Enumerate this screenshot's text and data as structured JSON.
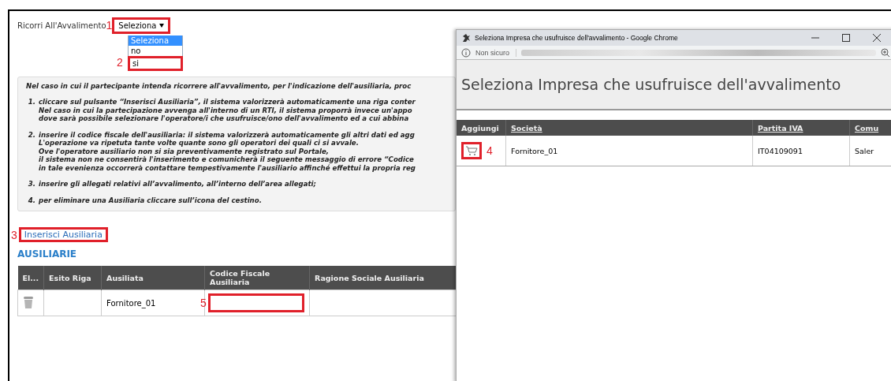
{
  "form": {
    "label": "Ricorri All'Avvalimento",
    "select": {
      "value": "Seleziona",
      "annotation": "1"
    },
    "options": [
      {
        "label": "Seleziona",
        "selected": true,
        "highlighted": false
      },
      {
        "label": "no",
        "selected": false,
        "highlighted": false
      },
      {
        "label": "si",
        "selected": false,
        "highlighted": true,
        "annotation": "2"
      }
    ]
  },
  "instructions": {
    "intro": "Nel caso in cui il partecipante intenda ricorrere all'avvalimento, per l'indicazione dell'ausiliaria, proc",
    "steps": [
      {
        "number": "1.",
        "lines": [
          "cliccare sul pulsante “Inserisci Ausiliaria”, il sistema valorizzerà automaticamente una riga conter",
          "Nel caso in cui la partecipazione avvenga all'interno di un RTI, il sistema proporrà invece un'appo",
          "dove sarà possibile selezionare l'operatore/i che usufruisce/ono dell'avvalimento ed a cui abbina"
        ]
      },
      {
        "number": "2.",
        "lines": [
          "inserire il codice fiscale dell'ausiliaria: il sistema valorizzerà automaticamente gli altri dati ed agg",
          "L'operazione va ripetuta tante volte quante sono gli operatori dei quali ci si avvale.",
          "Ove l'operatore ausiliario non si sia preventivamente registrato sul Portale,",
          "il sistema non ne consentirà l'inserimento e comunicherà il seguente messaggio di errore “Codice",
          "in tale evenienza occorrerà contattare tempestivamente l'ausiliario affinché effettui la propria reg"
        ]
      },
      {
        "number": "3.",
        "lines": [
          "inserire gli allegati relativi all’avvalimento, all’interno dell’area allegati;"
        ]
      },
      {
        "number": "4.",
        "lines": [
          "per eliminare una Ausiliaria cliccare sull’icona del cestino."
        ]
      }
    ]
  },
  "insert_link": {
    "label": "Inserisci Ausiliaria",
    "annotation": "3"
  },
  "section_title": "AUSILIARIE",
  "table": {
    "columns": [
      "El...",
      "Esito Riga",
      "Ausiliata",
      "Codice Fiscale Ausiliaria",
      "Ragione Sociale Ausiliaria"
    ],
    "rows": [
      {
        "esito": "",
        "ausiliata": "Fornitore_01",
        "codice_fiscale": "",
        "codice_annotation": "5",
        "ragione_sociale": ""
      }
    ]
  },
  "popup": {
    "window_title": "Seleziona Impresa che usufruisce dell'avvalimento - Google Chrome",
    "security": "Non sicuro",
    "heading": "Seleziona Impresa che usufruisce dell'avvalimento",
    "columns": [
      {
        "label": "Aggiungi",
        "sortable": false
      },
      {
        "label": "Società",
        "sortable": true
      },
      {
        "label": "Partita IVA",
        "sortable": true
      },
      {
        "label": "Comu",
        "sortable": true
      }
    ],
    "rows": [
      {
        "annotation": "4",
        "societa": "Fornitore_01",
        "partita_iva": "IT04109091",
        "comune": "Saler"
      }
    ]
  }
}
